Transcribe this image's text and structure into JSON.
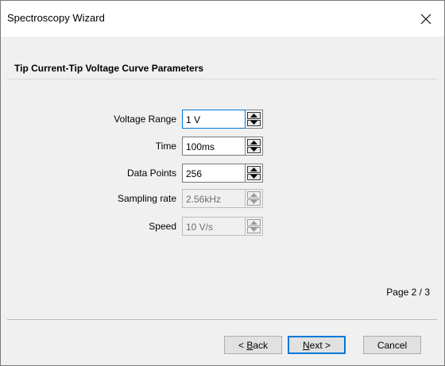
{
  "window": {
    "title": "Spectroscopy Wizard",
    "close_icon": "close-icon"
  },
  "section": {
    "title": "Tip Current-Tip Voltage Curve Parameters"
  },
  "fields": [
    {
      "label": "Voltage Range",
      "value": "1 V",
      "enabled": true,
      "focused": true
    },
    {
      "label": "Time",
      "value": "100ms",
      "enabled": true,
      "focused": false
    },
    {
      "label": "Data Points",
      "value": "256",
      "enabled": true,
      "focused": false
    },
    {
      "label": "Sampling rate",
      "value": "2.56kHz",
      "enabled": false,
      "focused": false
    },
    {
      "label": "Speed",
      "value": "10 V/s",
      "enabled": false,
      "focused": false
    }
  ],
  "page_indicator": "Page 2 / 3",
  "buttons": {
    "back": {
      "prefix": "< ",
      "accel": "B",
      "rest": "ack"
    },
    "next": {
      "accel": "N",
      "rest": "ext >"
    },
    "cancel": "Cancel"
  },
  "colors": {
    "accent": "#0078d7",
    "window_bg": "#f0f0f0",
    "title_bg": "#ffffff"
  }
}
